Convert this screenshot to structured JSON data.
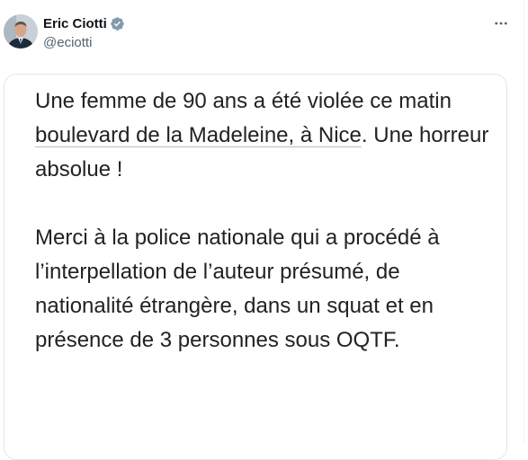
{
  "author": {
    "display_name": "Eric Ciotti",
    "handle": "@eciotti",
    "verified": true,
    "verified_color": "#829aab"
  },
  "more_icon": "more-horizontal-icon",
  "tweet": {
    "p1_before": "Une femme de 90 ans a été violée ce matin ",
    "p1_link": "boulevard de la Madeleine, à Nice",
    "p1_after": ". Une horreur absolue !",
    "p2": "Merci à la police nationale qui a procédé à l’interpellation de l’auteur présumé, de nationalité étrangère, dans un squat et en présence de 3 personnes sous OQTF."
  },
  "colors": {
    "text": "#222222",
    "secondary": "#536471",
    "border": "#e1e6ea"
  }
}
